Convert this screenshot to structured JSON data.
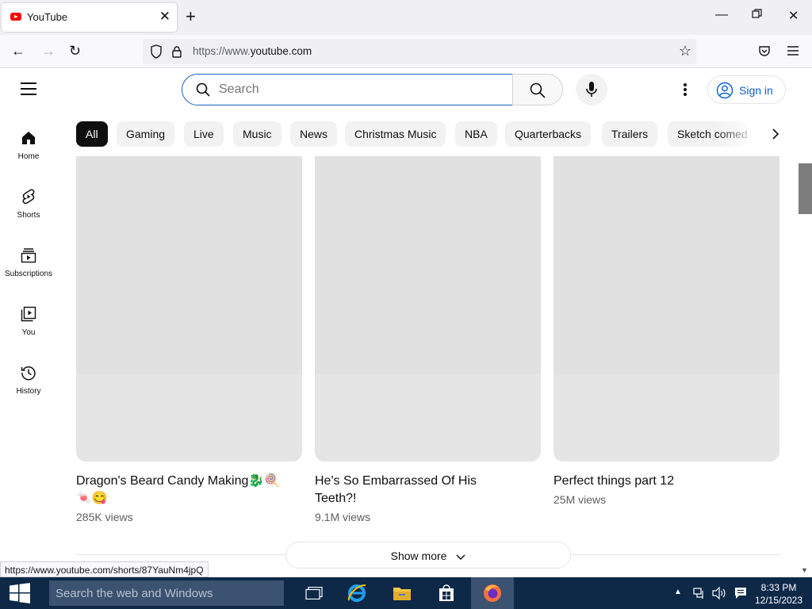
{
  "browser": {
    "tab_title": "YouTube",
    "url_prefix": "https://www.",
    "url_domain": "youtube.com",
    "status_url": "https://www.youtube.com/shorts/87YauNm4jpQ"
  },
  "header": {
    "search_placeholder": "Search",
    "sign_in_label": "Sign in"
  },
  "sidebar": {
    "items": [
      {
        "label": "Home",
        "icon": "home-icon"
      },
      {
        "label": "Shorts",
        "icon": "shorts-icon"
      },
      {
        "label": "Subscriptions",
        "icon": "subscriptions-icon"
      },
      {
        "label": "You",
        "icon": "you-icon"
      },
      {
        "label": "History",
        "icon": "history-icon"
      }
    ]
  },
  "chips": [
    "All",
    "Gaming",
    "Live",
    "Music",
    "News",
    "Christmas Music",
    "NBA",
    "Quarterbacks",
    "Trailers",
    "Sketch comedy"
  ],
  "videos": [
    {
      "title": "Dragon's Beard Candy Making🐉🍭🍬😋",
      "views": "285K views"
    },
    {
      "title": "He's So Embarrassed Of His Teeth?!",
      "views": "9.1M views"
    },
    {
      "title": "Perfect things part 12",
      "views": "25M views"
    }
  ],
  "show_more_label": "Show more",
  "taskbar": {
    "search_placeholder": "Search the web and Windows",
    "time": "8:33 PM",
    "date": "12/15/2023"
  },
  "colors": {
    "youtube_red": "#ff0000",
    "link_blue": "#065fd4",
    "search_focus": "#1c62b9",
    "taskbar": "#0e2848"
  }
}
